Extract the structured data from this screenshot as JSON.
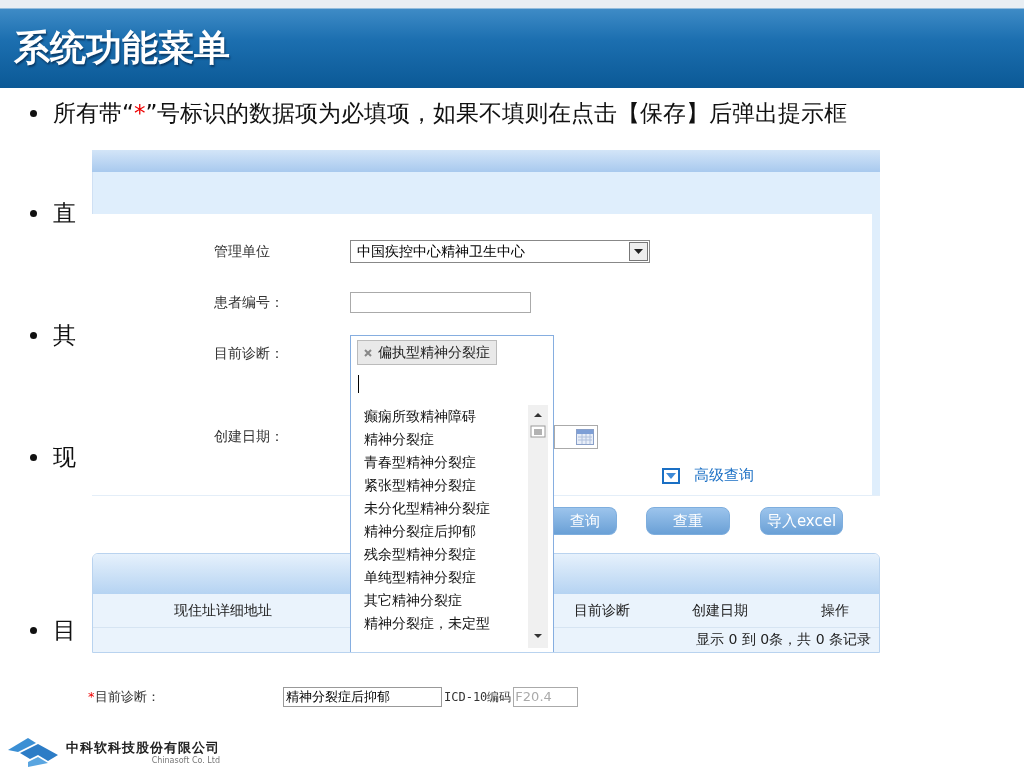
{
  "slide": {
    "title": "系统功能菜单",
    "bullets": [
      {
        "segments": [
          {
            "kind": "plain",
            "text": "所有带“"
          },
          {
            "kind": "required",
            "text": "*"
          },
          {
            "kind": "plain",
            "text": "”号标识的数据项为必填项，如果不填则在点击【保存】后弹出提示框"
          }
        ]
      },
      {
        "segments": [
          {
            "kind": "plain",
            "text": "直"
          }
        ]
      },
      {
        "segments": [
          {
            "kind": "plain",
            "text": "其"
          }
        ]
      },
      {
        "segments": [
          {
            "kind": "plain",
            "text": "现"
          }
        ]
      },
      {
        "segments": [
          {
            "kind": "plain",
            "text": "目"
          }
        ]
      }
    ]
  },
  "query_panel": {
    "fields": [
      {
        "kind": "select",
        "label": "管理单位",
        "value": "中国疾控中心精神卫生中心"
      },
      {
        "kind": "text",
        "label": "患者编号："
      },
      {
        "kind": "tags",
        "label": "目前诊断："
      },
      {
        "kind": "date",
        "label": "创建日期："
      }
    ],
    "advanced_query": "高级查询",
    "buttons": [
      "查询",
      "查重",
      "导入excel"
    ],
    "table": {
      "columns": [
        "现住址详细地址",
        "目前诊断",
        "创建日期",
        "操作"
      ],
      "footer": "显示 0 到 0条，共 0 条记录"
    }
  },
  "diagnosis_dropdown": {
    "tags": [
      "偏执型精神分裂症"
    ],
    "options": [
      "癫痫所致精神障碍",
      "精神分裂症",
      "青春型精神分裂症",
      "紧张型精神分裂症",
      "未分化型精神分裂症",
      "精神分裂症后抑郁",
      "残余型精神分裂症",
      "单纯型精神分裂症",
      "其它精神分裂症",
      "精神分裂症，未定型"
    ]
  },
  "diagnosis_row": {
    "label": "目前诊断：",
    "required": true,
    "value": "精神分裂症后抑郁",
    "code_label": "ICD-10编码",
    "code": "F20.4"
  },
  "company": {
    "name": "中科软科技股份有限公司",
    "english": "Chinasoft Co. Ltd"
  }
}
